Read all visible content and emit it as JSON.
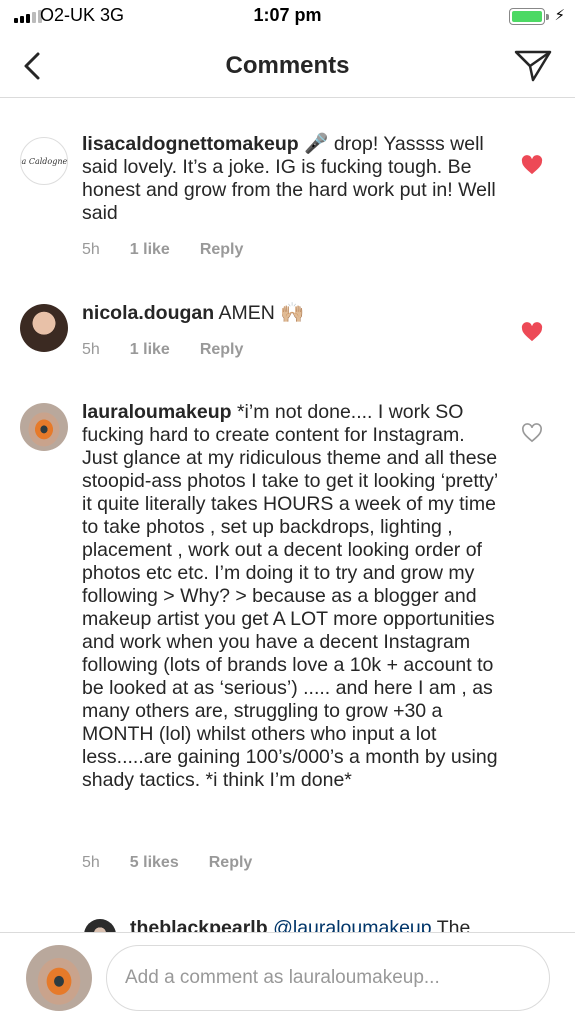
{
  "status_bar": {
    "carrier": "O2-UK  3G",
    "time": "1:07 pm",
    "bolt": "⚡"
  },
  "nav": {
    "title": "Comments",
    "back_icon": "chevron-left-icon",
    "share_icon": "paper-plane-icon"
  },
  "comments": [
    {
      "username": "lisacaldognettomakeup",
      "text": " 🎤 drop! Yassss well said lovely. It’s a joke. IG is fucking tough. Be honest and grow from the hard work put in! Well said",
      "avatar_text": "Lisa Caldognetto",
      "time": "5h",
      "likes": "1 like",
      "reply": "Reply",
      "liked": true
    },
    {
      "username": "nicola.dougan",
      "text": " AMEN 🙌🏼",
      "time": "5h",
      "likes": "1 like",
      "reply": "Reply",
      "liked": true
    },
    {
      "username": "lauraloumakeup",
      "text": " *i’m not done.... I work SO fucking hard to create content for Instagram. Just glance at my ridiculous theme and all these stoopid-ass photos I take to get it looking ‘pretty’ it quite literally takes HOURS a week of my time to take photos , set up backdrops, lighting , placement , work out a decent looking order of photos etc etc. I’m doing it to try and grow my following > Why? > because as a blogger and makeup artist you get A LOT more opportunities and work when you have a decent Instagram following (lots of brands love a 10k + account to be looked at as ‘serious’) ..... and here I am , as many others are, struggling to grow +30 a MONTH (lol) whilst others who input a lot less.....are gaining 100’s/000’s a month by using shady tactics. *i think I’m done*",
      "time": "5h",
      "likes": "5 likes",
      "reply": "Reply",
      "liked": false
    },
    {
      "username": "theblackpearlb",
      "mention": "@lauraloumakeup",
      "text": " The"
    }
  ],
  "composer": {
    "placeholder": "Add a comment as lauraloumakeup..."
  },
  "colors": {
    "like_red": "#ed4956",
    "meta_grey": "#999999",
    "mention_blue": "#003569",
    "battery_green": "#4cd964"
  }
}
